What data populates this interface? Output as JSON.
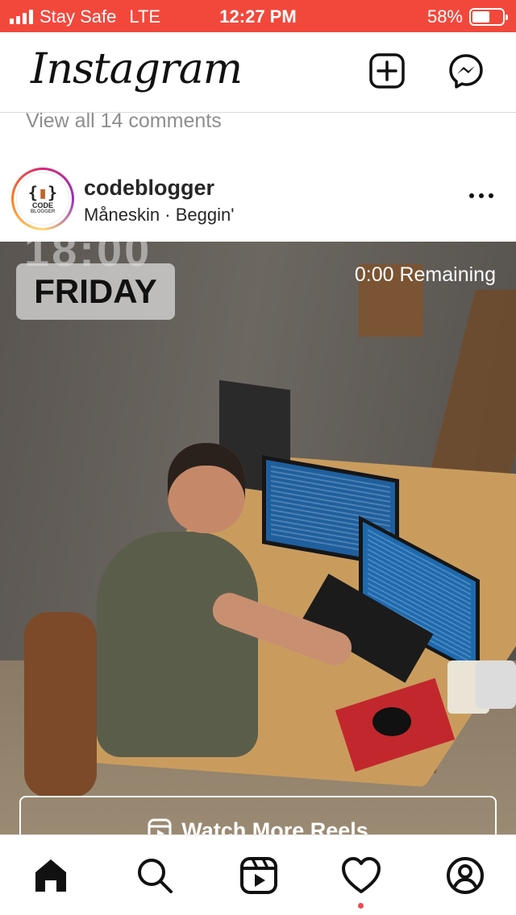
{
  "status_bar": {
    "carrier": "Stay Safe",
    "network": "LTE",
    "time": "12:27 PM",
    "battery": "58%",
    "battery_level": 0.58,
    "bar_color": "#f2483c"
  },
  "header": {
    "logo": "Instagram",
    "new_post_icon": "plus-square-icon",
    "messenger_icon": "messenger-icon"
  },
  "feed": {
    "view_comments": "View all 14 comments"
  },
  "post": {
    "username": "codeblogger",
    "audio": "Måneskin · Beggin'",
    "avatar": {
      "glyph_open": "{",
      "glyph_close": "}",
      "line1": "CODE",
      "line2": "BLOGGER"
    },
    "overlay": {
      "time_partial": "18:00",
      "day": "FRIDAY",
      "remaining": "0:00 Remaining",
      "more_reels": "Watch More Reels"
    }
  },
  "tab_bar": {
    "items": [
      "home-icon",
      "search-icon",
      "reels-icon",
      "activity-icon",
      "profile-icon"
    ],
    "notification_color": "#ed4956"
  }
}
